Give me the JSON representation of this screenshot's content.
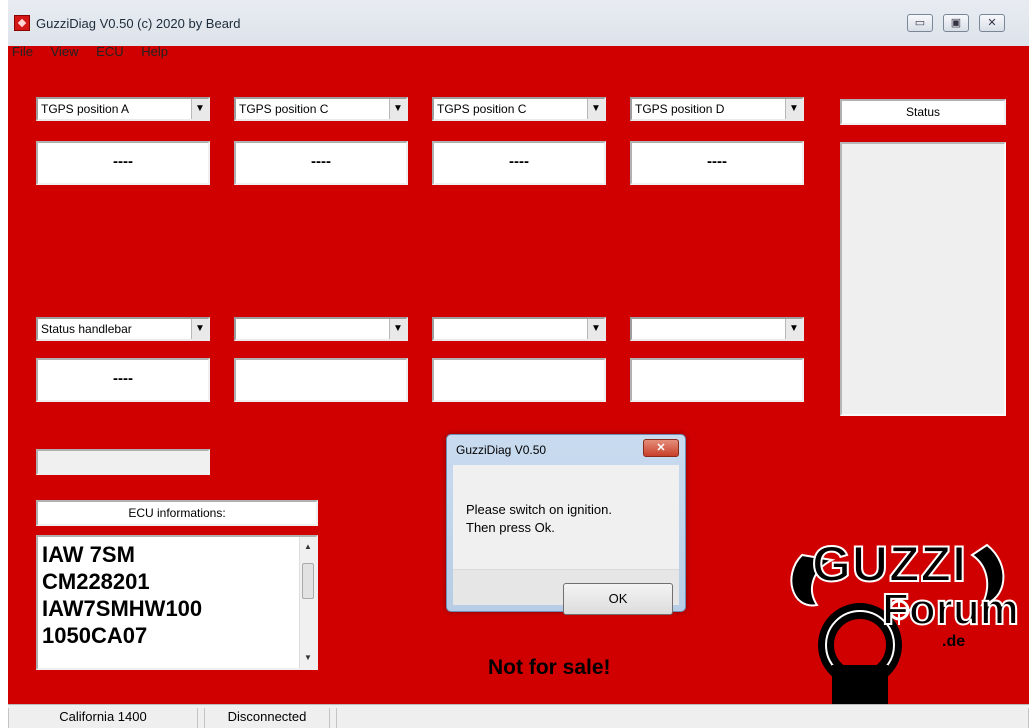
{
  "window": {
    "title": "GuzziDiag V0.50  (c) 2020 by Beard",
    "controls": {
      "minimize": "▭",
      "maximize": "▣",
      "close": "✕"
    }
  },
  "menu": [
    "File",
    "View",
    "ECU",
    "Help"
  ],
  "top_combos": [
    {
      "label": "TGPS position A",
      "value": "----"
    },
    {
      "label": "TGPS position C",
      "value": "----"
    },
    {
      "label": "TGPS position C",
      "value": "----"
    },
    {
      "label": "TGPS position D",
      "value": "----"
    }
  ],
  "bottom_combos": [
    {
      "label": "Status handlebar",
      "value": "----"
    },
    {
      "label": "",
      "value": ""
    },
    {
      "label": "",
      "value": ""
    },
    {
      "label": "",
      "value": ""
    }
  ],
  "combo_arrow": "▼",
  "status_label": "Status",
  "ecu": {
    "label": "ECU informations:",
    "lines": [
      "IAW 7SM",
      "CM228201",
      "IAW7SMHW100",
      "1050CA07"
    ]
  },
  "dialog": {
    "title": "GuzziDiag V0.50",
    "close": "✕",
    "message_line1": "Please switch on ignition.",
    "message_line2": "Then press Ok.",
    "ok_label": "OK"
  },
  "notice": "Not for sale!",
  "logo": {
    "line1": "GUZZI",
    "line2": "Forum",
    "line3": ".de"
  },
  "statusbar": {
    "model": "California 1400",
    "connection": "Disconnected"
  },
  "colors": {
    "background": "#d00000"
  }
}
